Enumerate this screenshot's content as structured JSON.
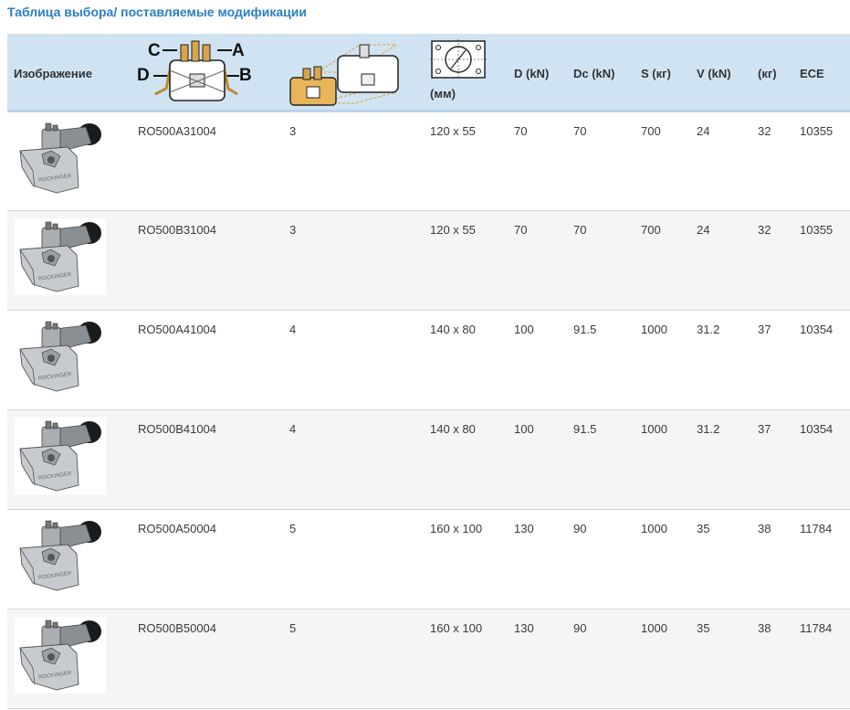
{
  "title": "Таблица выбора/ поставляемые модификации",
  "header": {
    "image": "Изображение",
    "adjust_labels": {
      "c": "C",
      "a": "A",
      "d": "D",
      "b": "B"
    },
    "mm": "(мм)",
    "d": "D (kN)",
    "dc": "Dc (kN)",
    "s": "S (кг)",
    "v": "V (kN)",
    "kg": "(кг)",
    "ece": "ECE"
  },
  "rows": [
    {
      "code": "RO500A31004",
      "size": "3",
      "dims": "120 x 55",
      "d": "70",
      "dc": "70",
      "s": "700",
      "v": "24",
      "kg": "32",
      "ece": "10355"
    },
    {
      "code": "RO500B31004",
      "size": "3",
      "dims": "120 x 55",
      "d": "70",
      "dc": "70",
      "s": "700",
      "v": "24",
      "kg": "32",
      "ece": "10355"
    },
    {
      "code": "RO500A41004",
      "size": "4",
      "dims": "140 x 80",
      "d": "100",
      "dc": "91.5",
      "s": "1000",
      "v": "31.2",
      "kg": "37",
      "ece": "10354"
    },
    {
      "code": "RO500B41004",
      "size": "4",
      "dims": "140 x 80",
      "d": "100",
      "dc": "91.5",
      "s": "1000",
      "v": "31.2",
      "kg": "37",
      "ece": "10354"
    },
    {
      "code": "RO500A50004",
      "size": "5",
      "dims": "160 x 100",
      "d": "130",
      "dc": "90",
      "s": "1000",
      "v": "35",
      "kg": "38",
      "ece": "11784"
    },
    {
      "code": "RO500B50004",
      "size": "5",
      "dims": "160 x 100",
      "d": "130",
      "dc": "90",
      "s": "1000",
      "v": "35",
      "kg": "38",
      "ece": "11784"
    }
  ],
  "colors": {
    "title": "#2a7fc1",
    "header_bg": "#cfe3f3",
    "alt_row": "#f5f5f5",
    "highlight": "#e8b55a"
  }
}
